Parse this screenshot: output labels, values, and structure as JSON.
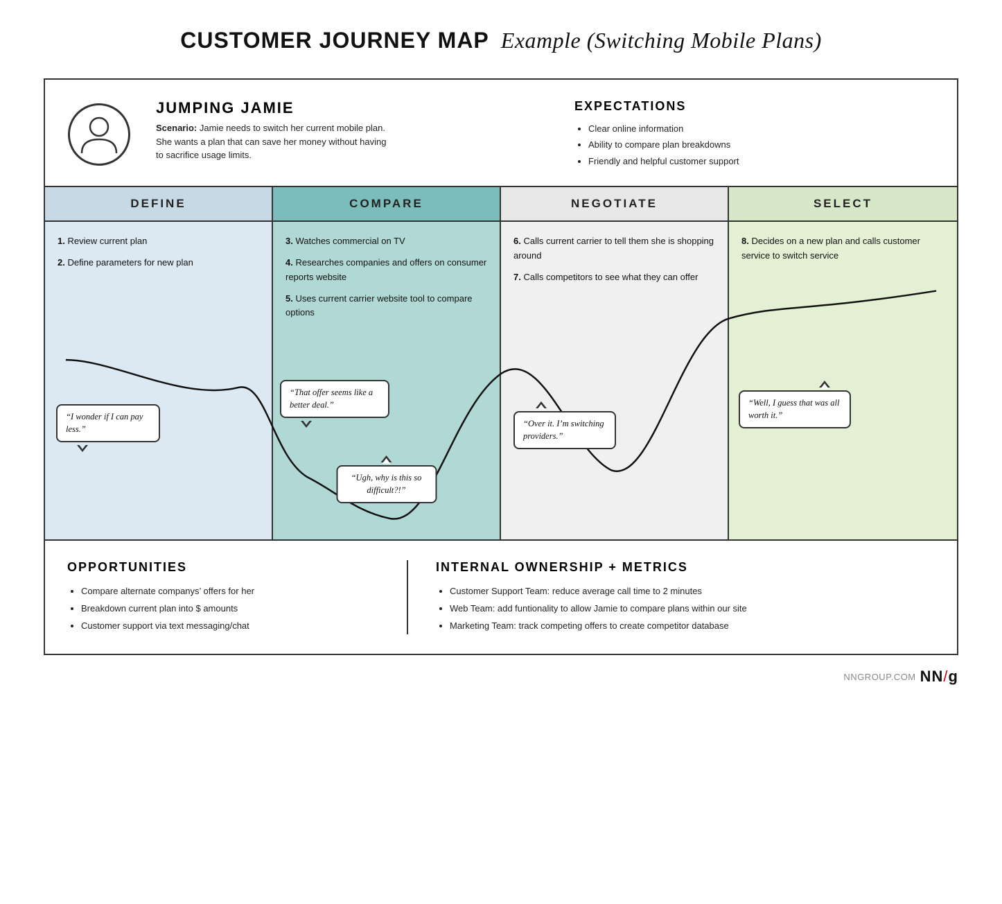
{
  "title": {
    "strong": "CUSTOMER JOURNEY MAP",
    "italic": "Example (Switching Mobile Plans)"
  },
  "persona": {
    "name": "JUMPING JAMIE",
    "scenario_label": "Scenario:",
    "scenario_text": "Jamie needs to switch her current mobile plan. She wants a plan that can save her money without having to sacrifice usage limits.",
    "avatar_alt": "user avatar"
  },
  "expectations": {
    "title": "EXPECTATIONS",
    "items": [
      "Clear online information",
      "Ability to compare plan breakdowns",
      "Friendly and helpful customer support"
    ]
  },
  "phases": [
    {
      "id": "define",
      "label": "DEFINE"
    },
    {
      "id": "compare",
      "label": "COMPARE"
    },
    {
      "id": "negotiate",
      "label": "NEGOTIATE"
    },
    {
      "id": "select",
      "label": "SELECT"
    }
  ],
  "journey": {
    "define": {
      "steps": [
        {
          "num": "1.",
          "text": "Review current plan"
        },
        {
          "num": "2.",
          "text": "Define parameters for new plan"
        }
      ],
      "bubble": "“I wonder if I can pay less.”"
    },
    "compare": {
      "steps": [
        {
          "num": "3.",
          "text": "Watches commercial on TV"
        },
        {
          "num": "4.",
          "text": "Researches companies and offers on consumer reports website"
        },
        {
          "num": "5.",
          "text": "Uses current carrier website tool to compare options"
        }
      ],
      "bubble1": "“That offer seems like a better deal.”",
      "bubble2": "“Ugh, why is this so difficult?!”"
    },
    "negotiate": {
      "steps": [
        {
          "num": "6.",
          "text": "Calls current carrier to tell them she is shopping around"
        },
        {
          "num": "7.",
          "text": "Calls competitors to see what they can offer"
        }
      ],
      "bubble": "“Over it. I’m switching providers.”"
    },
    "select": {
      "steps": [
        {
          "num": "8.",
          "text": "Decides on a new plan and calls customer service to switch service"
        }
      ],
      "bubble": "“Well, I guess that was all worth it.”"
    }
  },
  "opportunities": {
    "title": "OPPORTUNITIES",
    "items": [
      "Compare alternate companys’ offers for her",
      "Breakdown current plan into $ amounts",
      "Customer support via text messaging/chat"
    ]
  },
  "internal": {
    "title": "INTERNAL OWNERSHIP + METRICS",
    "items": [
      "Customer Support Team: reduce average call time to 2 minutes",
      "Web Team: add funtionality to allow Jamie to compare plans within our site",
      "Marketing Team: track competing offers to create competitor database"
    ]
  },
  "branding": {
    "site": "NNGROUP.COM",
    "logo": "NN/g"
  }
}
